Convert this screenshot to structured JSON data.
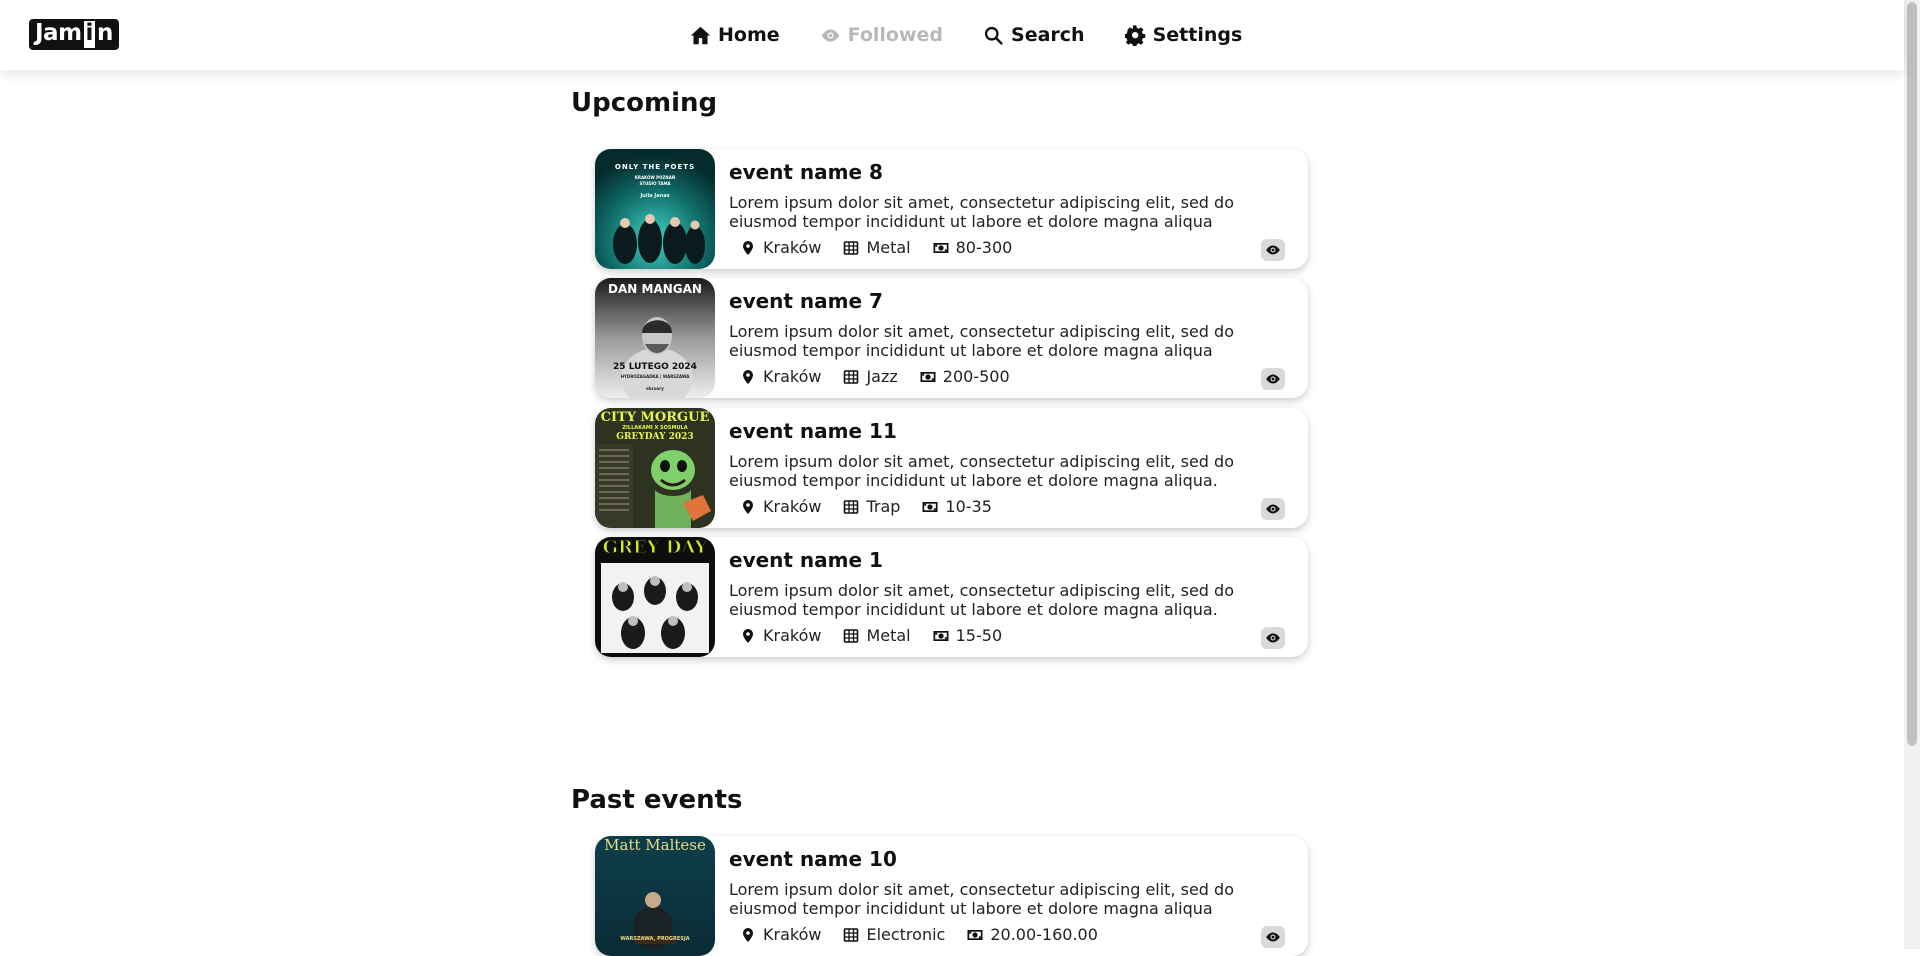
{
  "app": {
    "logo_part1": "Jam",
    "logo_part2": "i",
    "logo_part3": "n"
  },
  "nav": [
    {
      "label": "Home",
      "icon": "home-icon",
      "state": "normal"
    },
    {
      "label": "Followed",
      "icon": "eye-icon",
      "state": "dimmed"
    },
    {
      "label": "Search",
      "icon": "search-icon",
      "state": "normal"
    },
    {
      "label": "Settings",
      "icon": "gear-icon",
      "state": "normal"
    }
  ],
  "sections": {
    "upcoming": "Upcoming",
    "past": "Past events"
  },
  "upcoming_events": [
    {
      "title": "event name 8",
      "desc_line1": "Lorem ipsum dolor sit amet, consectetur adipiscing elit, sed do",
      "desc_line2": "eiusmod tempor incididunt ut labore et dolore magna aliqua",
      "city": "Kraków",
      "genre": "Metal",
      "price": "80-300",
      "poster": {
        "heading": "ONLY THE POETS",
        "sub": "KRAKÓW   POZNAŃ",
        "extra": "STUDIO   TAMA",
        "name": "Julia Janas"
      }
    },
    {
      "title": "event name 7",
      "desc_line1": "Lorem ipsum dolor sit amet, consectetur adipiscing elit, sed do",
      "desc_line2": "eiusmod tempor incididunt ut labore et dolore magna aliqua",
      "city": "Kraków",
      "genre": "Jazz",
      "price": "200-500",
      "poster": {
        "heading": "DAN MANGAN",
        "sub": "25 LUTEGO 2024",
        "extra": "HYDROZAGADKA | WARSZAWA",
        "name": "ebruary"
      }
    },
    {
      "title": "event name 11",
      "desc_line1": "Lorem ipsum dolor sit amet, consectetur adipiscing elit, sed do",
      "desc_line2": "eiusmod tempor incididunt ut labore et dolore magna aliqua.",
      "city": "Kraków",
      "genre": "Trap",
      "price": "10-35",
      "poster": {
        "heading": "CITY MORGUE",
        "sub": "ZILLAKAMI X SOSMULA",
        "extra": "GREYDAY 2023"
      }
    },
    {
      "title": "event name 1",
      "desc_line1": "Lorem ipsum dolor sit amet, consectetur adipiscing elit, sed do",
      "desc_line2": "eiusmod tempor incididunt ut labore et dolore magna aliqua.",
      "city": "Kraków",
      "genre": "Metal",
      "price": "15-50",
      "poster": {
        "heading": "GREY DAY"
      }
    }
  ],
  "past_events": [
    {
      "title": "event name 10",
      "desc_line1": "Lorem ipsum dolor sit amet, consectetur adipiscing elit, sed do",
      "desc_line2": "eiusmod tempor incididunt ut labore et dolore magna aliqua",
      "city": "Kraków",
      "genre": "Electronic",
      "price": "20.00-160.00",
      "poster": {
        "heading": "Matt Maltese",
        "sub": "WARSZAWA, PROGRESJA"
      }
    }
  ],
  "colors": {
    "accent": "#111111",
    "dimmed_nav": "#b8b8b8",
    "card_shadow": "rgba(0,0,0,0.2)"
  }
}
